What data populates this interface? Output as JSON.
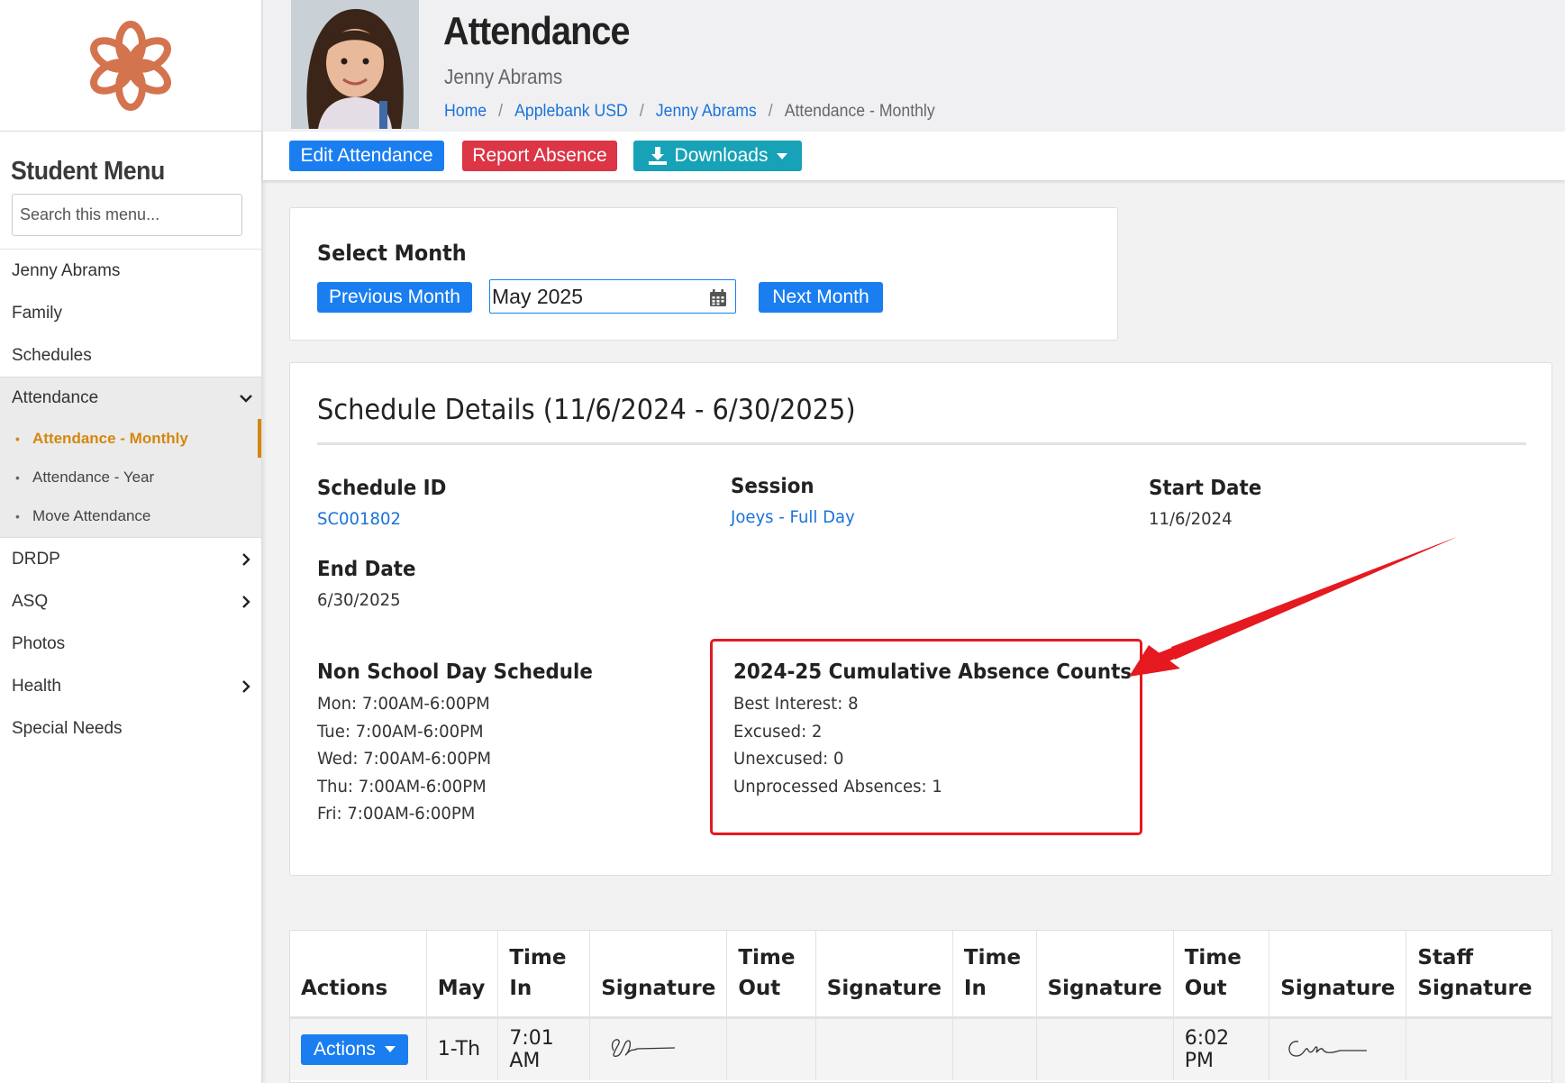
{
  "sidebar": {
    "title": "Student Menu",
    "search_placeholder": "Search this menu...",
    "items": [
      {
        "label": "Jenny Abrams"
      },
      {
        "label": "Family"
      },
      {
        "label": "Schedules"
      },
      {
        "label": "Attendance"
      },
      {
        "label": "DRDP"
      },
      {
        "label": "ASQ"
      },
      {
        "label": "Photos"
      },
      {
        "label": "Health"
      },
      {
        "label": "Special Needs"
      }
    ],
    "attendance_sub": [
      {
        "label": "Attendance - Monthly"
      },
      {
        "label": "Attendance - Year"
      },
      {
        "label": "Move Attendance"
      }
    ]
  },
  "header": {
    "title": "Attendance",
    "student_name": "Jenny Abrams",
    "breadcrumb": [
      "Home",
      "Applebank USD",
      "Jenny Abrams",
      "Attendance - Monthly"
    ]
  },
  "toolbar": {
    "edit_label": "Edit Attendance",
    "report_label": "Report Absence",
    "downloads_label": "Downloads"
  },
  "select_month": {
    "title": "Select Month",
    "prev_label": "Previous Month",
    "month_value": "May 2025",
    "next_label": "Next Month"
  },
  "schedule": {
    "title": "Schedule Details (11/6/2024 - 6/30/2025)",
    "schedule_id_label": "Schedule ID",
    "schedule_id": "SC001802",
    "session_label": "Session",
    "session": "Joeys - Full Day",
    "start_label": "Start Date",
    "start_date": "11/6/2024",
    "end_label": "End Date",
    "end_date": "6/30/2025",
    "nsd_label": "Non School Day Schedule",
    "nsd_lines": [
      "Mon: 7:00AM-6:00PM",
      "Tue: 7:00AM-6:00PM",
      "Wed: 7:00AM-6:00PM",
      "Thu: 7:00AM-6:00PM",
      "Fri: 7:00AM-6:00PM"
    ],
    "absence_label": "2024-25 Cumulative Absence Counts",
    "absence_lines": [
      "Best Interest: 8",
      "Excused: 2",
      "Unexcused: 0",
      "Unprocessed Absences: 1"
    ]
  },
  "table": {
    "headers": [
      "Actions",
      "May",
      "Time In",
      "Signature",
      "Time Out",
      "Signature",
      "Time In",
      "Signature",
      "Time Out",
      "Signature",
      "Staff Signature"
    ],
    "rows": [
      {
        "actions_label": "Actions",
        "day": "1-Th",
        "time_in": "7:01 AM",
        "time_out_1": "",
        "time_in_2": "",
        "time_out_2": "6:02 PM"
      }
    ]
  },
  "colors": {
    "accent": "#1a7ef0",
    "danger": "#dc3545",
    "teal": "#17a2b8",
    "active_menu": "#d4870e",
    "logo": "#d4744f",
    "annotation": "#e5191f"
  }
}
